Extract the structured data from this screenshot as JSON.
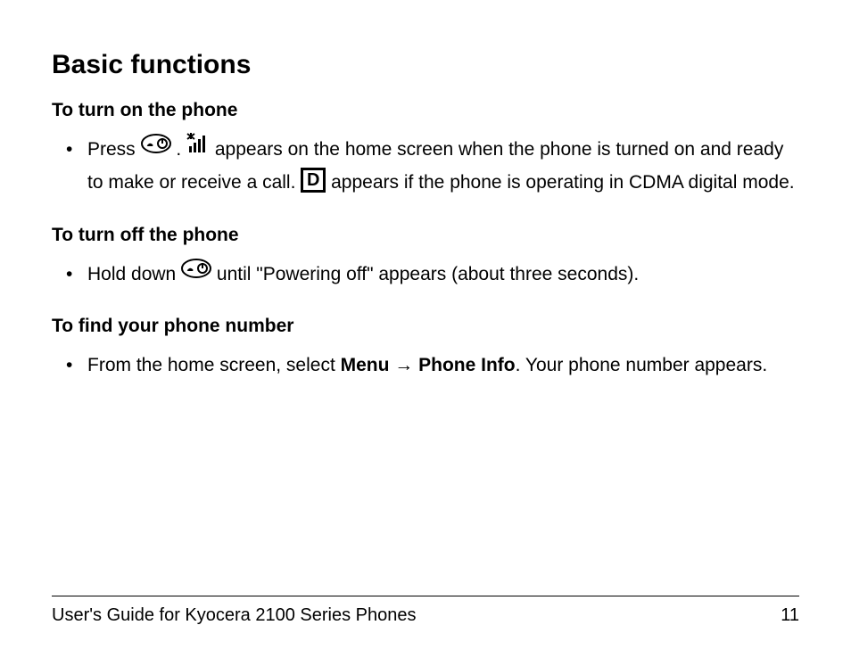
{
  "title": "Basic functions",
  "sections": [
    {
      "heading": "To turn on the phone",
      "item": {
        "t1": "Press ",
        "t2": ". ",
        "t3": " appears on the home screen when the phone is turned on and ready to make or receive a call. ",
        "t4": " appears if the phone is operating in CDMA digital mode."
      }
    },
    {
      "heading": "To turn off the phone",
      "item": {
        "t1": "Hold down ",
        "t2": " until \"Powering off\" appears (about three seconds)."
      }
    },
    {
      "heading": "To find your phone number",
      "item": {
        "t1": "From the home screen, select ",
        "menu": "Menu",
        "arrow": " → ",
        "phoneinfo": "Phone Info",
        "t2": ". Your phone number appears."
      }
    }
  ],
  "icons": {
    "d_letter": "D"
  },
  "footer": {
    "left": "User's Guide for Kyocera 2100 Series Phones",
    "right": "11"
  }
}
